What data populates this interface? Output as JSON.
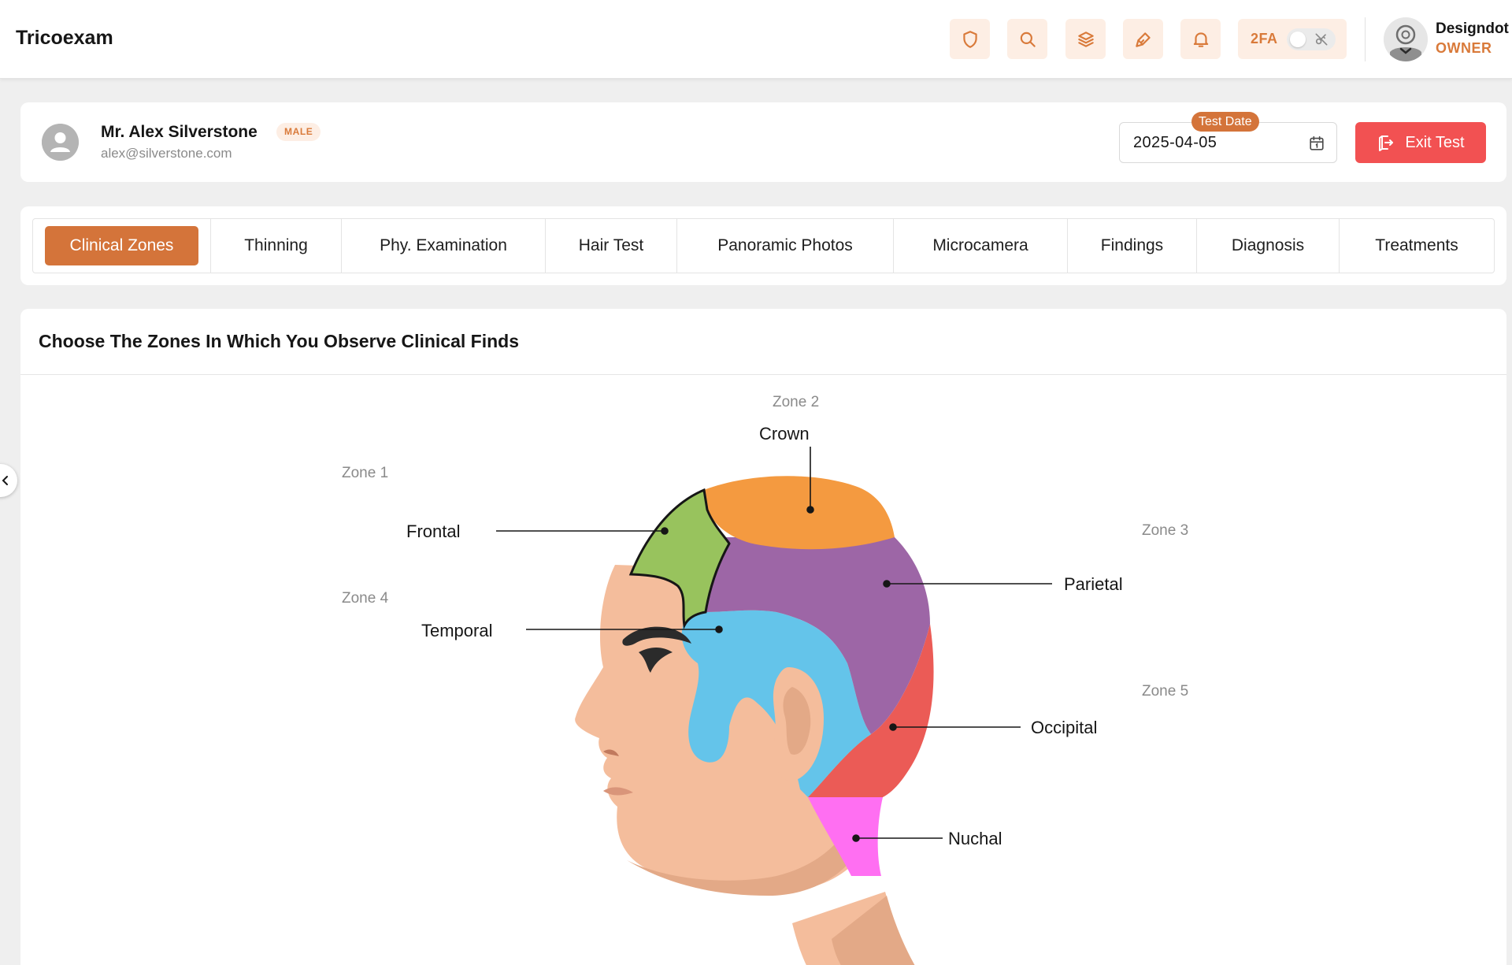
{
  "app": {
    "brand": "Tricoexam"
  },
  "toolbar": {
    "icons": [
      "shield-icon",
      "search-icon",
      "layers-icon",
      "brush-icon",
      "bell-icon"
    ],
    "twofa_label": "2FA",
    "twofa_enabled": false
  },
  "user": {
    "name": "Designdot",
    "role": "OWNER"
  },
  "patient": {
    "name": "Mr. Alex Silverstone",
    "gender": "MALE",
    "email": "alex@silverstone.com",
    "test_date_label": "Test Date",
    "test_date": "2025-04-05",
    "exit_label": "Exit Test"
  },
  "tabs": [
    {
      "label": "Clinical Zones",
      "active": true
    },
    {
      "label": "Thinning",
      "active": false
    },
    {
      "label": "Phy. Examination",
      "active": false
    },
    {
      "label": "Hair Test",
      "active": false
    },
    {
      "label": "Panoramic Photos",
      "active": false
    },
    {
      "label": "Microcamera",
      "active": false
    },
    {
      "label": "Findings",
      "active": false
    },
    {
      "label": "Diagnosis",
      "active": false
    },
    {
      "label": "Treatments",
      "active": false
    }
  ],
  "main": {
    "title": "Choose The Zones In Which You Observe Clinical Finds",
    "zones": [
      {
        "zone": "Zone 1",
        "area": "Frontal",
        "color": "#98c35d"
      },
      {
        "zone": "Zone 2",
        "area": "Crown",
        "color": "#f49a40"
      },
      {
        "zone": "Zone 3",
        "area": "Parietal",
        "color": "#9d66a6"
      },
      {
        "zone": "Zone 4",
        "area": "Temporal",
        "color": "#64c4ea"
      },
      {
        "zone": "Zone 5",
        "area": "Occipital",
        "color": "#eb5b56"
      },
      {
        "zone": "",
        "area": "Nuchal",
        "color": "#ff6ff2"
      }
    ]
  },
  "colors": {
    "accent": "#d4743a",
    "accent_light": "#fdeee4",
    "danger": "#f25152",
    "skin": "#f4bd9c"
  }
}
